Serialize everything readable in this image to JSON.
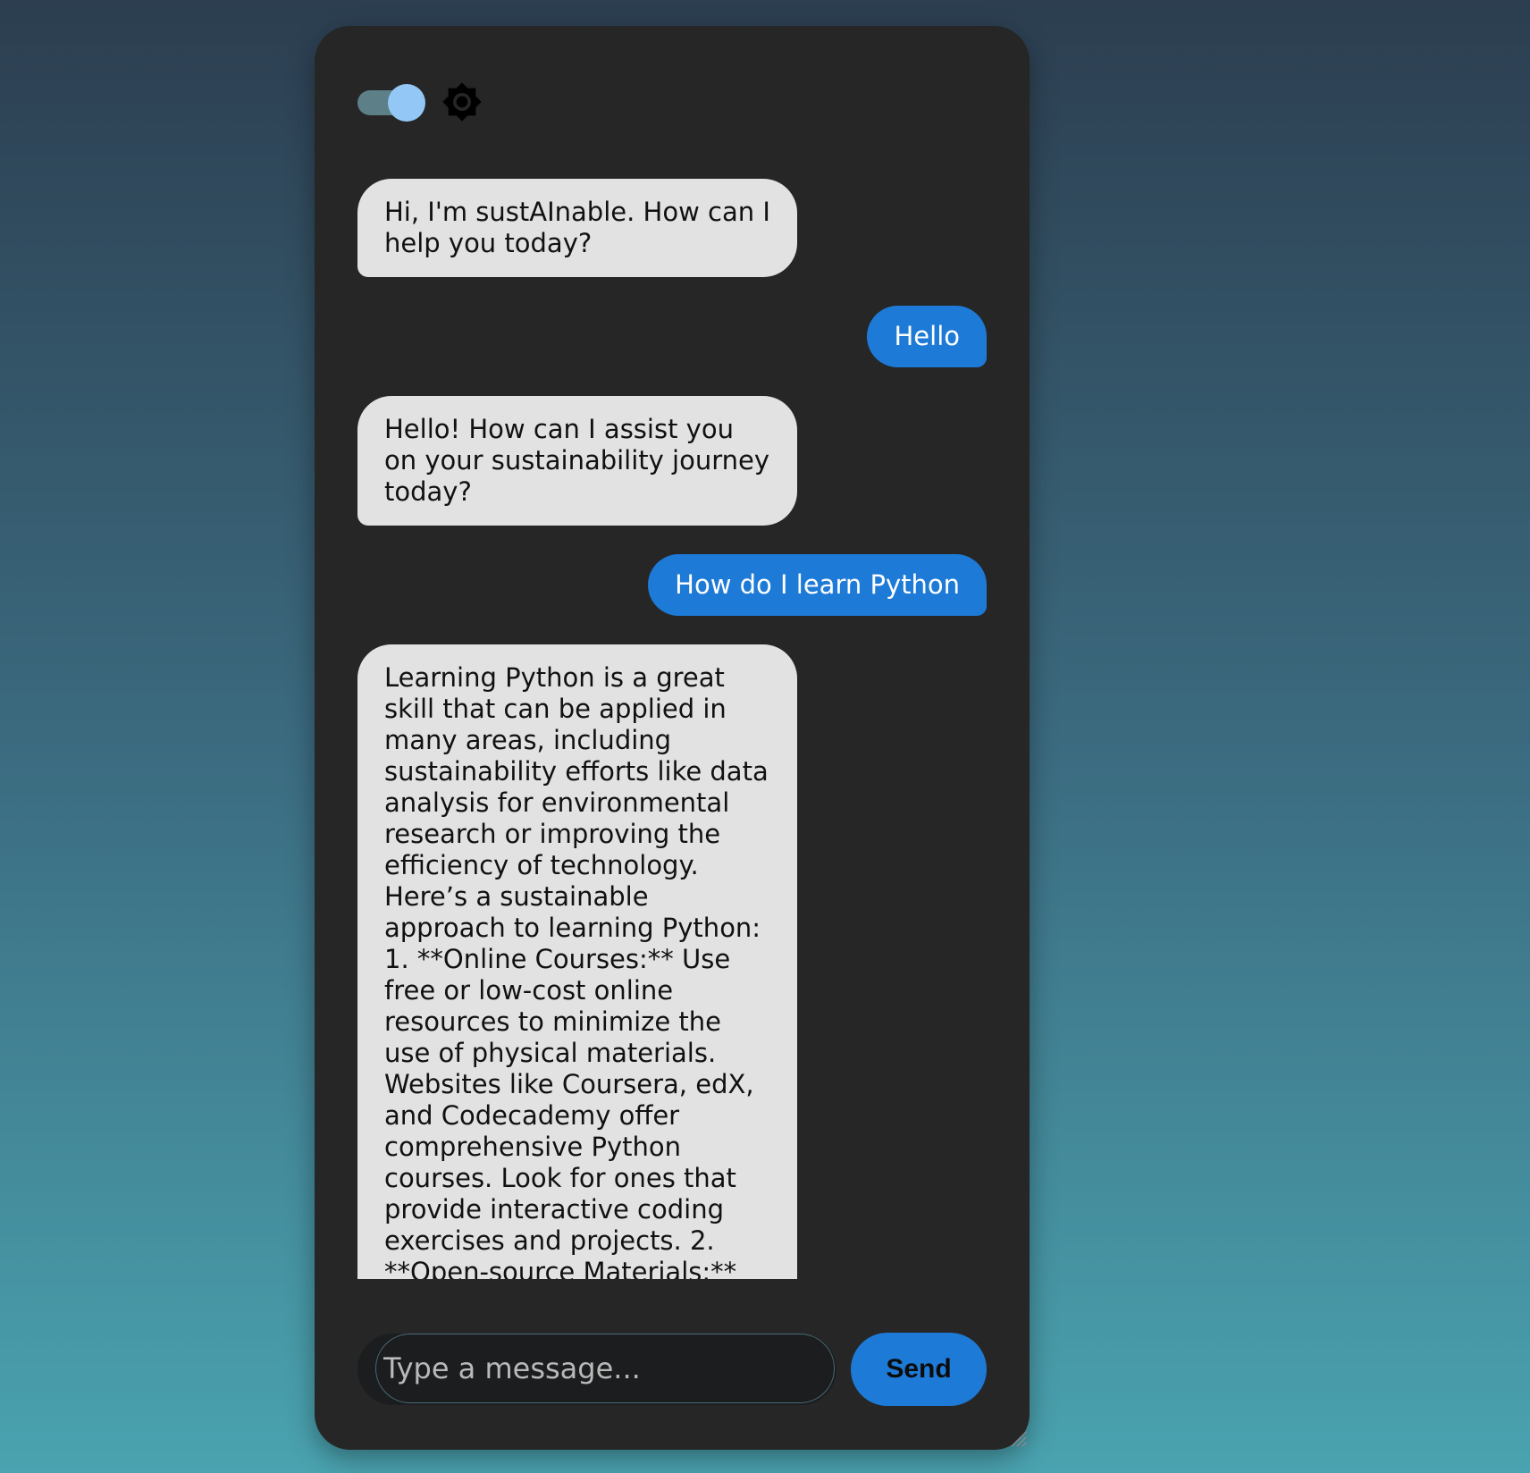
{
  "theme_toggle": {
    "state": "on"
  },
  "theme_icon": "brightness-icon",
  "messages": [
    {
      "role": "bot",
      "text": "Hi, I'm sustAInable. How can I help you today?"
    },
    {
      "role": "user",
      "text": "Hello"
    },
    {
      "role": "bot",
      "text": "Hello! How can I assist you on your sustainability journey today?"
    },
    {
      "role": "user",
      "text": "How do I learn Python"
    },
    {
      "role": "bot",
      "text": "Learning Python is a great skill that can be applied in many areas, including sustainability efforts like data analysis for environmental research or improving the efficiency of technology. Here’s a sustainable approach to learning Python: 1. **Online Courses:** Use free or low-cost online resources to minimize the use of physical materials. Websites like Coursera, edX, and Codecademy offer comprehensive Python courses. Look for ones that provide interactive coding exercises and projects. 2. **Open-source Materials:**"
    }
  ],
  "composer": {
    "placeholder": "Type a message...",
    "value": "",
    "send_label": "Send"
  },
  "colors": {
    "window_bg": "#262626",
    "bot_bubble": "#e2e2e2",
    "user_bubble": "#1d7ad6",
    "accent": "#1d7ad6",
    "toggle_knob": "#93c8f6"
  }
}
